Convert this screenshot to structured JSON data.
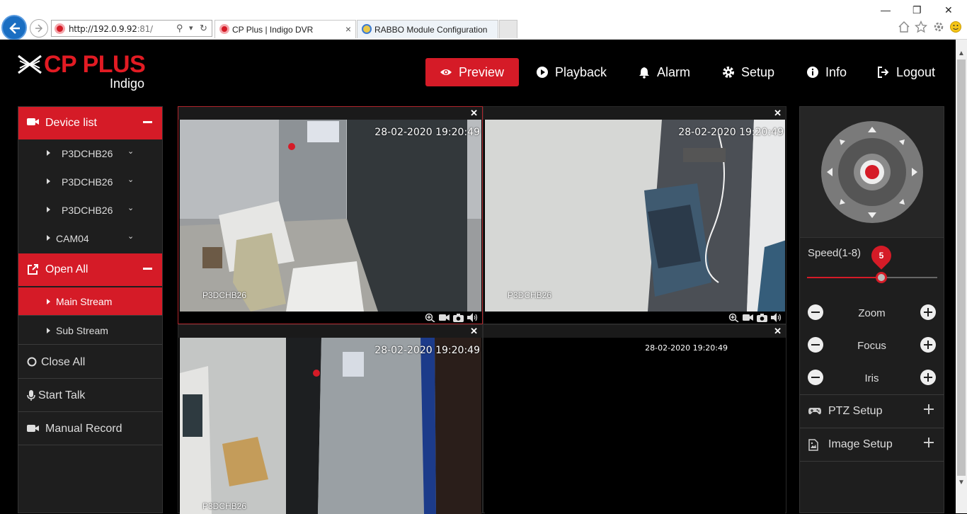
{
  "browser": {
    "url_host": "http://192.0.9.92",
    "url_port": ":81/",
    "tabs": [
      {
        "title": "CP Plus | Indigo DVR",
        "close": "×"
      },
      {
        "title": "RABBO Module Configuration"
      }
    ],
    "search_glyph": "⚲",
    "dropdown_glyph": "▾",
    "refresh_glyph": "↻",
    "window": {
      "minimize": "—",
      "restore": "❐",
      "close": "✕"
    },
    "toolbar_icons": [
      "home-icon",
      "star-icon",
      "gear-icon",
      "smiley-icon"
    ]
  },
  "header": {
    "brand": "CP PLUS",
    "product": "Indigo",
    "menu": [
      {
        "label": "Preview",
        "icon": "eye-icon",
        "active": true
      },
      {
        "label": "Playback",
        "icon": "play-circle-icon"
      },
      {
        "label": "Alarm",
        "icon": "bell-icon"
      },
      {
        "label": "Setup",
        "icon": "gear-icon"
      },
      {
        "label": "Info",
        "icon": "info-icon"
      },
      {
        "label": "Logout",
        "icon": "sign-out-icon"
      }
    ]
  },
  "sidebar": {
    "device_list_label": "Device list",
    "devices": [
      "P3DCHB26",
      "P3DCHB26",
      "P3DCHB26",
      "CAM04"
    ],
    "open_all_label": "Open All",
    "streams": [
      {
        "label": "Main Stream",
        "active": true
      },
      {
        "label": "Sub Stream",
        "active": false
      }
    ],
    "actions": [
      {
        "label": "Close All",
        "icon": "circle-icon"
      },
      {
        "label": "Start Talk",
        "icon": "microphone-icon"
      },
      {
        "label": "Manual Record",
        "icon": "video-camera-icon"
      }
    ]
  },
  "video": {
    "cells": [
      {
        "timestamp": "28-02-2020 19:20:49",
        "camera": "P3DCHB26",
        "selected": true
      },
      {
        "timestamp": "28-02-2020 19:20:49",
        "camera": "P3DCHB26",
        "selected": false
      },
      {
        "timestamp": "28-02-2020 19:20:49",
        "camera": "P3DCHB26",
        "selected": false
      },
      {
        "timestamp": "28-02-2020 19:20:49",
        "camera": "",
        "selected": false
      }
    ],
    "close_glyph": "✕",
    "tool_icons": [
      "zoom-in-icon",
      "record-icon",
      "snapshot-icon",
      "audio-icon"
    ]
  },
  "ptz": {
    "speed_label": "Speed(1-8)",
    "speed_value": "5",
    "speed_level": 5,
    "speed_max": 8,
    "rows": [
      "Zoom",
      "Focus",
      "Iris"
    ],
    "sections": [
      {
        "label": "PTZ Setup",
        "icon": "gamepad-icon"
      },
      {
        "label": "Image Setup",
        "icon": "image-file-icon"
      }
    ]
  },
  "colors": {
    "accent": "#d51b27",
    "panel": "#1e1e1e",
    "background": "#000000"
  }
}
